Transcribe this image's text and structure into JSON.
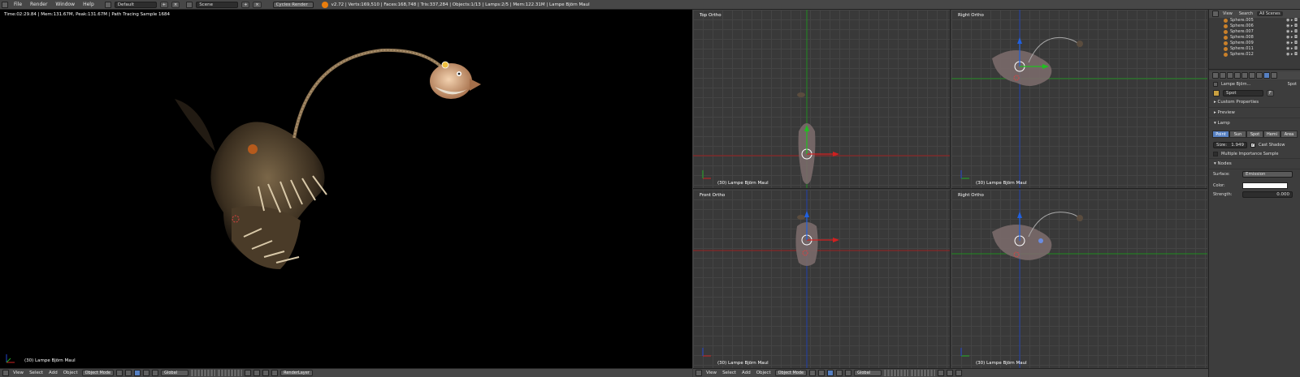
{
  "topbar": {
    "menus": [
      "File",
      "Render",
      "Window",
      "Help"
    ],
    "screen_layout": "Default",
    "scene": "Scene",
    "engine": "Cycles Render",
    "stats": "v2.72 | Verts:169,510 | Faces:168,748 | Tris:337,284 | Objects:1/13 | Lamps:2/5 | Mem:122.31M | Lampe Björn Maul"
  },
  "render_view": {
    "info": "Time:02:29.84 | Mem:131.67M, Peak:131.67M | Path Tracing Sample 1684",
    "object_label": "(30) Lampe Björn Maul"
  },
  "ortho_views": [
    {
      "name": "Top Ortho",
      "label": "(30) Lampe Björn Maul"
    },
    {
      "name": "Right Ortho",
      "label": "(30) Lampe Björn Maul"
    },
    {
      "name": "Front Ortho",
      "label": "(30) Lampe Björn Maul"
    },
    {
      "name": "Right Ortho",
      "label": "(30) Lampe Björn Maul"
    }
  ],
  "bottom_left": {
    "menus": [
      "View",
      "Select",
      "Add",
      "Object"
    ],
    "mode": "Object Mode",
    "orientation": "Global",
    "render_layer": "RenderLayer"
  },
  "bottom_right": {
    "menus": [
      "View",
      "Select",
      "Add",
      "Object"
    ],
    "mode": "Object Mode",
    "orientation": "Global"
  },
  "outliner": {
    "tabs": [
      "View",
      "Search",
      "All Scenes"
    ],
    "items": [
      "Sphere.005",
      "Sphere.006",
      "Sphere.007",
      "Sphere.008",
      "Sphere.009",
      "Sphere.011",
      "Sphere.012"
    ]
  },
  "properties": {
    "breadcrumb": "Lampe Björn...",
    "breadcrumb_end": "Spot",
    "datablock": "Spot",
    "datablock_users": "F",
    "sections": {
      "custom_props": "Custom Properties",
      "preview": "Preview",
      "lamp": "Lamp",
      "nodes": "Nodes"
    },
    "lamp_types": [
      "Point",
      "Sun",
      "Spot",
      "Hemi",
      "Area"
    ],
    "active_lamp_type": "Point",
    "size_label": "Size:",
    "size_value": "1.949",
    "cast_shadow": "Cast Shadow",
    "mis": "Multiple Importance Sample",
    "surface_label": "Surface:",
    "surface_value": "Emission",
    "color_label": "Color:",
    "strength_label": "Strength:",
    "strength_value": "0.000"
  },
  "colors": {
    "accent_blue": "#5680c2",
    "x_axis": "#cc2222",
    "y_axis": "#22aa22",
    "z_axis": "#2244cc"
  }
}
